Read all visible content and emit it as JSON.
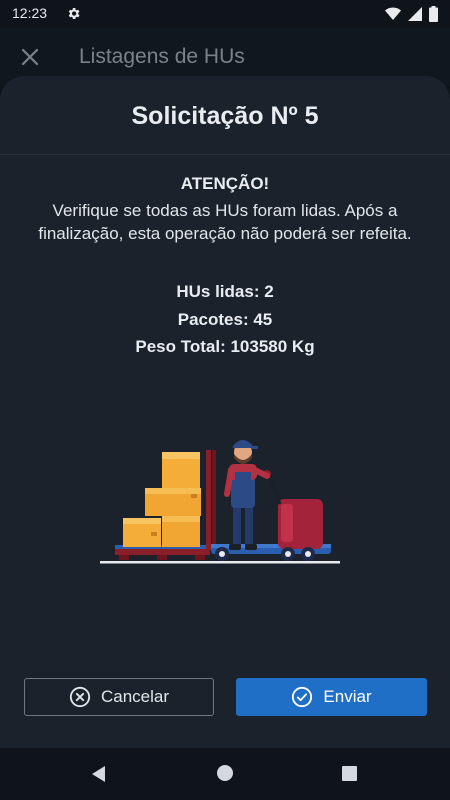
{
  "status_bar": {
    "time": "12:23",
    "icons": [
      "gear-icon",
      "wifi-icon",
      "signal-icon",
      "battery-icon"
    ]
  },
  "app_bar": {
    "title": "Listagens de HUs",
    "close_icon": "close-icon"
  },
  "dialog": {
    "title": "Solicitação Nº 5",
    "warning_title": "ATENÇÃO!",
    "warning_text": "Verifique se todas as HUs foram lidas. Após a finalização, esta operação não poderá ser refeita.",
    "stats": {
      "hus_lidas": "HUs lidas: 2",
      "pacotes": "Pacotes: 45",
      "peso_total": "Peso Total: 103580 Kg"
    },
    "illustration": "warehouse-worker-pallet-jack",
    "cancel_label": "Cancelar",
    "send_label": "Enviar"
  },
  "colors": {
    "background": "#0f141b",
    "sheet": "#1b222c",
    "primary": "#1e6fc5",
    "text": "#e9edf1"
  }
}
